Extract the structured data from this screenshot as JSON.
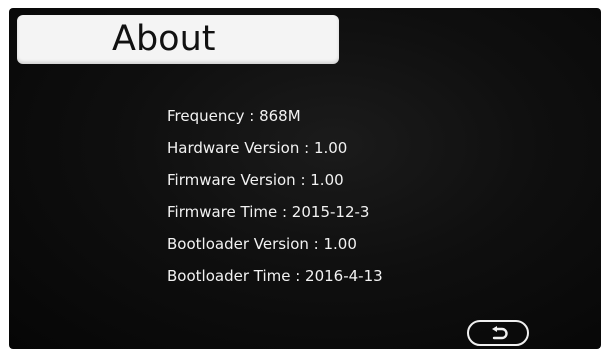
{
  "header": {
    "title": "About"
  },
  "info": [
    {
      "text": "Frequency : 868M"
    },
    {
      "text": "Hardware Version : 1.00"
    },
    {
      "text": "Firmware Version : 1.00"
    },
    {
      "text": "Firmware Time : 2015-12-3"
    },
    {
      "text": "Bootloader Version : 1.00"
    },
    {
      "text": "Bootloader Time : 2016-4-13"
    }
  ],
  "footer": {
    "back_icon": "return-arrow-icon"
  },
  "colors": {
    "screen_background": "#0a0a0a",
    "title_box": "#f4f4f4",
    "text": "#f2f2f2"
  }
}
